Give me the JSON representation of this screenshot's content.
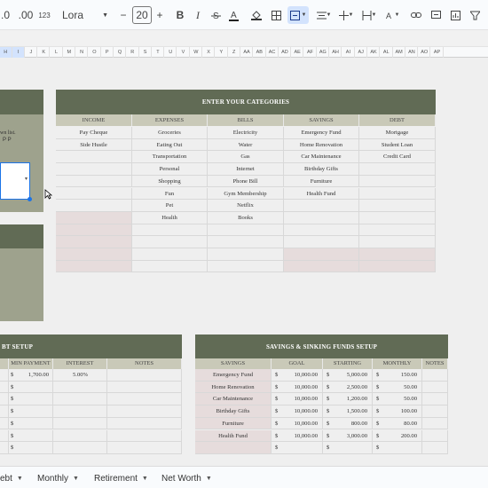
{
  "toolbar": {
    "decimal_decrease": ".0",
    "decimal_increase": ".00",
    "format_123": "123",
    "font": "Lora",
    "font_size": "20",
    "minus": "−",
    "plus": "+",
    "bold": "B",
    "italic": "I"
  },
  "columns": [
    "H",
    "I",
    "J",
    "K",
    "L",
    "M",
    "N",
    "O",
    "P",
    "Q",
    "R",
    "S",
    "T",
    "U",
    "V",
    "W",
    "X",
    "Y",
    "Z",
    "AA",
    "AB",
    "AC",
    "AD",
    "AE",
    "AF",
    "AG",
    "AH",
    "AI",
    "AJ",
    "AK",
    "AL",
    "AM",
    "AN",
    "AO",
    "AP"
  ],
  "categories": {
    "title": "ENTER YOUR CATEGORIES",
    "headers": [
      "INCOME",
      "EXPENSES",
      "BILLS",
      "SAVINGS",
      "DEBT"
    ],
    "income": [
      "Pay Cheque",
      "Side Hustle",
      "",
      "",
      "",
      "",
      "",
      "",
      "",
      "",
      "",
      ""
    ],
    "expenses": [
      "Groceries",
      "Eating Out",
      "Transportation",
      "Personal",
      "Shopping",
      "Fun",
      "Pet",
      "Health",
      "",
      "",
      "",
      ""
    ],
    "bills": [
      "Electricity",
      "Water",
      "Gas",
      "Internet",
      "Phone Bill",
      "Gym Membership",
      "Netflix",
      "Books",
      "",
      "",
      "",
      ""
    ],
    "savings": [
      "Emergency Fund",
      "Home Renovation",
      "Car Maintenance",
      "Birthday Gifts",
      "Furniture",
      "Health Fund",
      "",
      "",
      "",
      "",
      "",
      ""
    ],
    "debt": [
      "Mortgage",
      "Student Loan",
      "Credit Card",
      "",
      "",
      "",
      "",
      "",
      "",
      "",
      "",
      ""
    ]
  },
  "left_panel": {
    "text_line1": "wn list.",
    "text_line2": "P",
    "text_line2b": "P"
  },
  "debt_setup": {
    "title": "BT SETUP",
    "headers": [
      "MIN PAYMENT",
      "INTEREST",
      "NOTES"
    ],
    "rows": [
      [
        "$",
        "1,700.00",
        "5.00%",
        ""
      ],
      [
        "$",
        "",
        "",
        ""
      ],
      [
        "$",
        "",
        "",
        ""
      ],
      [
        "$",
        "",
        "",
        ""
      ],
      [
        "$",
        "",
        "",
        ""
      ],
      [
        "$",
        "",
        "",
        ""
      ],
      [
        "$",
        "",
        "",
        ""
      ]
    ]
  },
  "savings_setup": {
    "title": "SAVINGS & SINKING FUNDS SETUP",
    "headers": [
      "SAVINGS",
      "GOAL",
      "STARTING",
      "MONTHLY",
      "NOTES"
    ],
    "rows": [
      [
        "Emergency Fund",
        "$",
        "10,000.00",
        "$",
        "5,000.00",
        "$",
        "150.00"
      ],
      [
        "Home Renovation",
        "$",
        "10,000.00",
        "$",
        "2,500.00",
        "$",
        "50.00"
      ],
      [
        "Car Maintenance",
        "$",
        "10,000.00",
        "$",
        "1,200.00",
        "$",
        "50.00"
      ],
      [
        "Birthday Gifts",
        "$",
        "10,000.00",
        "$",
        "1,500.00",
        "$",
        "100.00"
      ],
      [
        "Furniture",
        "$",
        "10,000.00",
        "$",
        "800.00",
        "$",
        "80.00"
      ],
      [
        "Health Fund",
        "$",
        "10,000.00",
        "$",
        "3,000.00",
        "$",
        "200.00"
      ],
      [
        "",
        "$",
        "",
        "$",
        "",
        "$",
        ""
      ]
    ]
  },
  "tabs": [
    "ebt",
    "Monthly",
    "Retirement",
    "Net Worth"
  ]
}
